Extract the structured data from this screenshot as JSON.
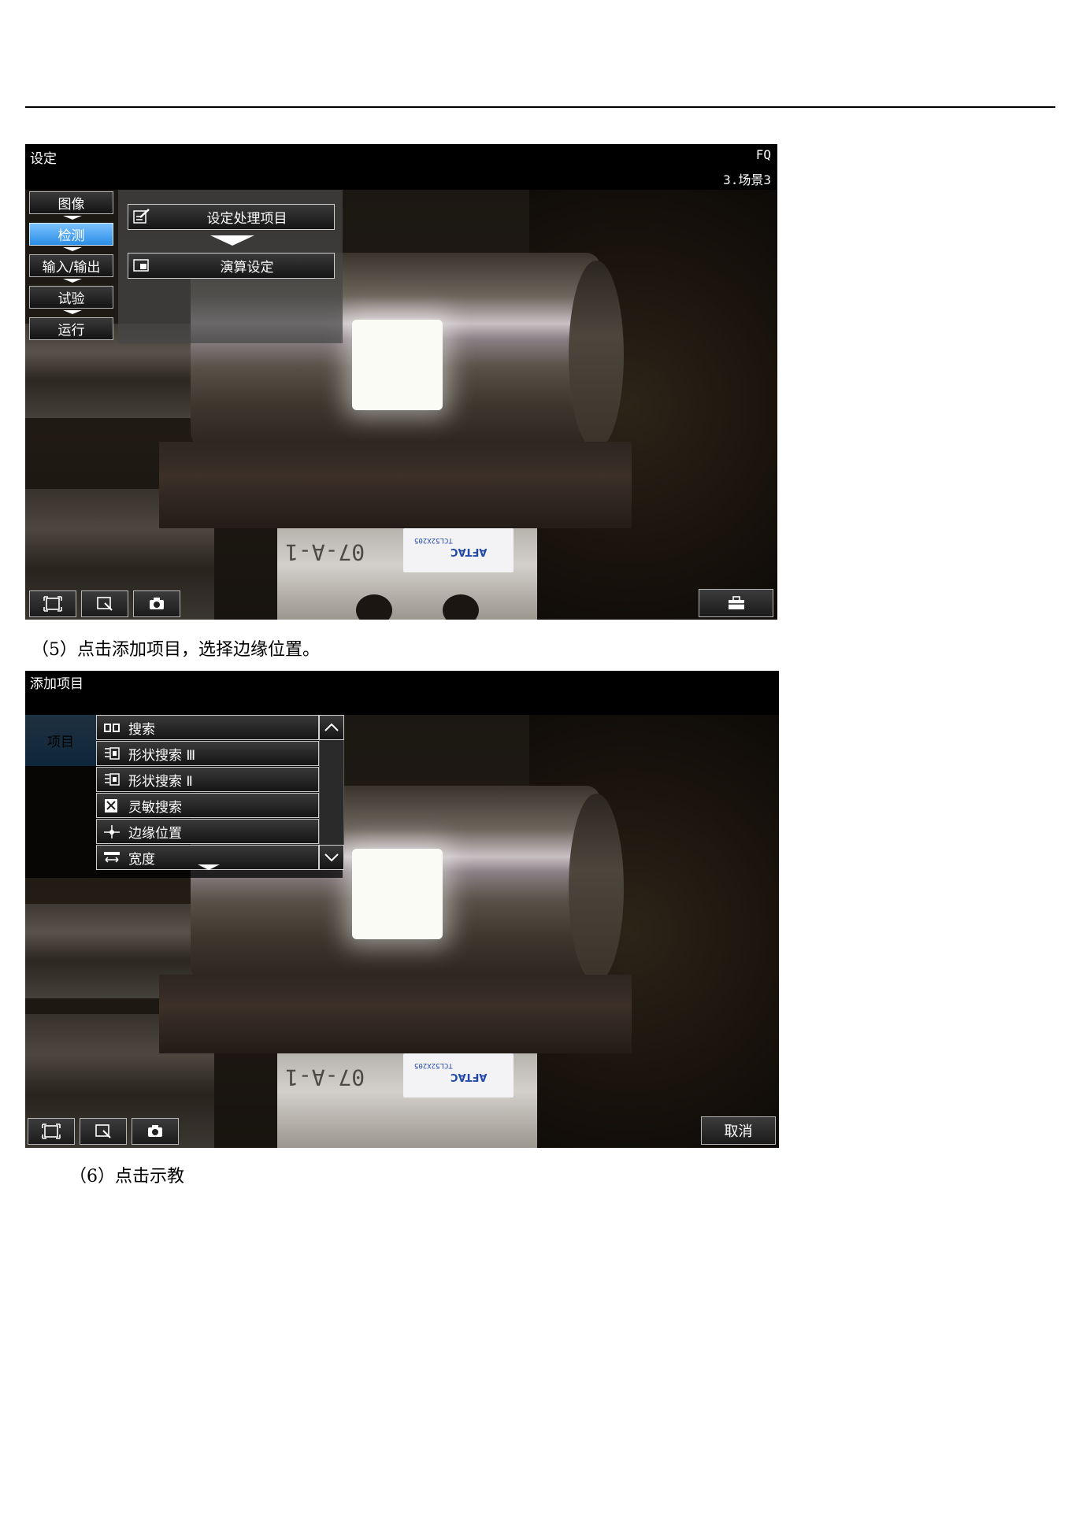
{
  "screen1": {
    "title": "设定",
    "model": "FQ",
    "scene": "3.场景3",
    "side_menu": [
      {
        "label": "图像",
        "active": false
      },
      {
        "label": "检测",
        "active": true
      },
      {
        "label": "输入/输出",
        "active": false
      },
      {
        "label": "试验",
        "active": false
      },
      {
        "label": "运行",
        "active": false
      }
    ],
    "panel": {
      "set_items_label": "设定处理项目",
      "calc_settings_label": "演算设定"
    },
    "photo": {
      "block_text": "07-A-1",
      "label_brand": "AFTAC",
      "label_small": "TCL52X205"
    },
    "bottom_icons": [
      "fit-screen-icon",
      "zoom-icon",
      "camera-icon",
      "toolbox-icon"
    ]
  },
  "caption1": "（5）点击添加项目，选择边缘位置。",
  "screen2": {
    "title": "添加项目",
    "items_tab": "项目",
    "list": [
      {
        "icon": "search-icon",
        "label": "搜索"
      },
      {
        "icon": "shape-search-3-icon",
        "label": "形状搜索 Ⅲ"
      },
      {
        "icon": "shape-search-2-icon",
        "label": "形状搜索 Ⅱ"
      },
      {
        "icon": "sensitive-search-icon",
        "label": "灵敏搜索"
      },
      {
        "icon": "edge-position-icon",
        "label": "边缘位置"
      },
      {
        "icon": "width-icon",
        "label": "宽度"
      }
    ],
    "photo": {
      "block_text": "07-A-1",
      "label_brand": "AFTAC",
      "label_small": "TCL52X205"
    },
    "bottom_icons": [
      "fit-screen-icon",
      "zoom-icon",
      "camera-icon"
    ],
    "cancel_label": "取消"
  },
  "caption2": "（6）点击示教"
}
